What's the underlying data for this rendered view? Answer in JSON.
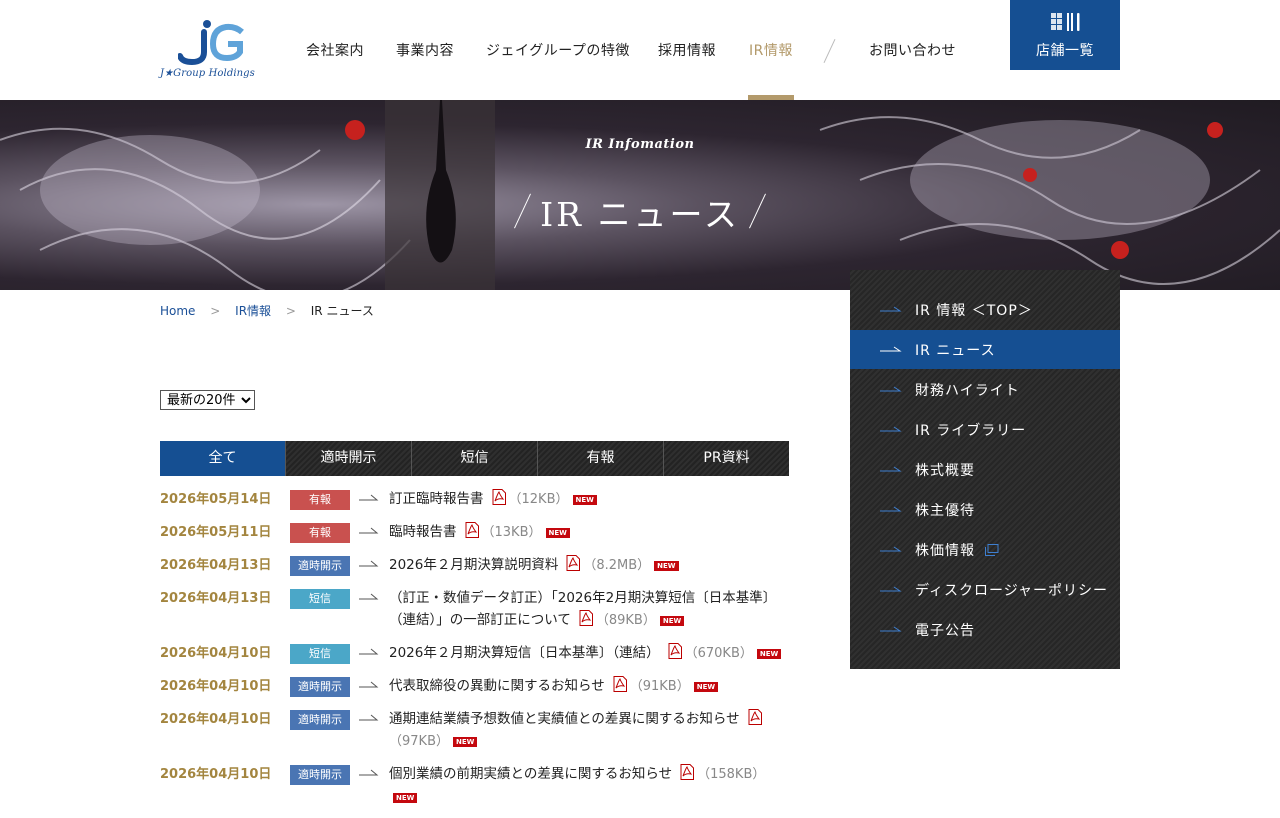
{
  "header": {
    "logo_text": "J★Group Holdings",
    "logo_mark": "JG",
    "nav": [
      "会社案内",
      "事業内容",
      "ジェイグループの特徴",
      "採用情報",
      "IR情報",
      "お問い合わせ"
    ],
    "nav_active_index": 4,
    "shop_button": {
      "label": "店舗一覧",
      "icon": "shop-list-icon"
    }
  },
  "hero": {
    "subtitle": "IR Infomation",
    "title": "IR ニュース"
  },
  "breadcrumb": [
    "Home",
    "IR情報",
    "IR ニュース"
  ],
  "breadcrumb_separator": ">",
  "count_select": {
    "selected": "最新の20件"
  },
  "filter_tabs": [
    "全て",
    "適時開示",
    "短信",
    "有報",
    "PR資料"
  ],
  "filter_active_index": 0,
  "new_badge": "NEW",
  "badge_colors": {
    "有報": "#c9514f",
    "適時開示": "#4a75b3",
    "短信": "#4ba7c8"
  },
  "news": [
    {
      "date": "2026年05月14日",
      "category": "有報",
      "title": "訂正臨時報告書",
      "size": "（12KB）",
      "is_new": true
    },
    {
      "date": "2026年05月11日",
      "category": "有報",
      "title": "臨時報告書",
      "size": "（13KB）",
      "is_new": true
    },
    {
      "date": "2026年04月13日",
      "category": "適時開示",
      "title": "2026年２月期決算説明資料",
      "size": "（8.2MB）",
      "is_new": true
    },
    {
      "date": "2026年04月13日",
      "category": "短信",
      "title": "（訂正・数値データ訂正）「2026年2月期決算短信〔日本基準〕（連結）」の一部訂正について",
      "size": "（89KB）",
      "is_new": true
    },
    {
      "date": "2026年04月10日",
      "category": "短信",
      "title": "2026年２月期決算短信〔日本基準〕（連結）",
      "size": "（670KB）",
      "is_new": true
    },
    {
      "date": "2026年04月10日",
      "category": "適時開示",
      "title": "代表取締役の異動に関するお知らせ",
      "size": "（91KB）",
      "is_new": true
    },
    {
      "date": "2026年04月10日",
      "category": "適時開示",
      "title": "通期連結業績予想数値と実績値との差異に関するお知らせ",
      "size": "（97KB）",
      "is_new": true
    },
    {
      "date": "2026年04月10日",
      "category": "適時開示",
      "title": "個別業績の前期実績との差異に関するお知らせ",
      "size": "（158KB）",
      "is_new": true
    }
  ],
  "sidebar": {
    "items": [
      "IR 情報 ＜TOP＞",
      "IR ニュース",
      "財務ハイライト",
      "IR ライブラリー",
      "株式概要",
      "株主優待",
      "株価情報",
      "ディスクロージャーポリシー",
      "電子公告"
    ],
    "active_index": 1,
    "external_index": 6
  }
}
